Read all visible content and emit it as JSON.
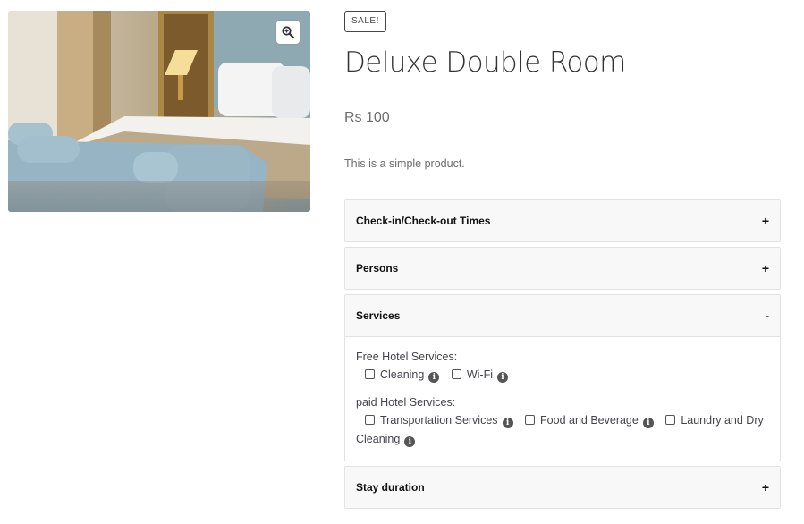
{
  "product": {
    "badge": "SALE!",
    "title": "Deluxe Double Room",
    "price": "Rs 100",
    "short_description": "This is a simple product."
  },
  "gallery": {
    "zoom_icon": "zoom-in-icon"
  },
  "accordion": {
    "items": [
      {
        "label": "Check-in/Check-out Times",
        "toggle": "+"
      },
      {
        "label": "Persons",
        "toggle": "+"
      },
      {
        "label": "Services",
        "toggle": "-"
      },
      {
        "label": "Stay duration",
        "toggle": "+"
      }
    ],
    "services": {
      "free_title": "Free Hotel Services:",
      "free_options": [
        "Cleaning",
        "Wi-Fi"
      ],
      "paid_title": "paid Hotel Services:",
      "paid_options": [
        "Transportation Services",
        "Food and Beverage",
        "Laundry and Dry Cleaning"
      ]
    },
    "info_icon": "info-icon",
    "info_glyph": "i"
  }
}
